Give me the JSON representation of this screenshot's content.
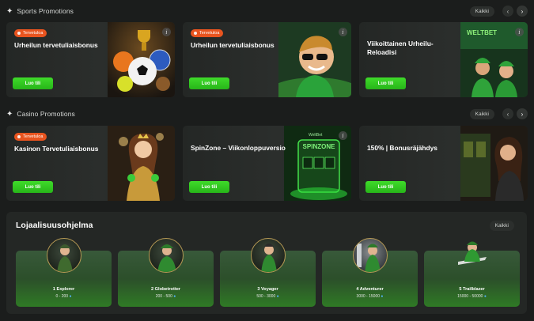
{
  "sports": {
    "heading": "Sports Promotions",
    "all_label": "Kaikki",
    "cards": [
      {
        "badge": "Tervetuloa",
        "title": "Urheilun tervetuliaisbonus",
        "cta": "Luo tili"
      },
      {
        "badge": "Tervetuloa",
        "title": "Urheilun tervetuliaisbonus",
        "cta": "Luo tili"
      },
      {
        "badge": "",
        "title": "Viikoittainen Urheilu-Reloadisi",
        "cta": "Luo tili",
        "art_text": "WELTBET"
      }
    ]
  },
  "casino": {
    "heading": "Casino Promotions",
    "all_label": "Kaikki",
    "cards": [
      {
        "badge": "Tervetuloa",
        "title": "Kasinon Tervetuliaisbonus",
        "cta": "Luo tili"
      },
      {
        "badge": "",
        "title": "SpinZone – Viikonloppuversio",
        "cta": "Luo tili",
        "art_text": "SPINZONE",
        "art_sub": "WeltBet"
      },
      {
        "badge": "",
        "title": "150% | Bonusräjähdys",
        "cta": "Luo tili"
      }
    ]
  },
  "loyalty": {
    "heading": "Lojaalisuusohjelma",
    "all_label": "Kaikki",
    "tiers": [
      {
        "name": "1 Explorer",
        "range": "0 - 200"
      },
      {
        "name": "2 Globetrotter",
        "range": "200 - 500"
      },
      {
        "name": "3 Voyager",
        "range": "500 - 3000"
      },
      {
        "name": "4 Adventurer",
        "range": "3000 - 15000"
      },
      {
        "name": "5 Trailblazer",
        "range": "15000 - 50000"
      }
    ]
  },
  "colors": {
    "accent": "#2fc51f",
    "badge": "#e8541f",
    "background": "#1b1d1c"
  },
  "icons": {
    "section": "sparkle-icon",
    "prev": "chevron-left-icon",
    "next": "chevron-right-icon",
    "info": "info-icon",
    "coin": "coin-icon"
  }
}
